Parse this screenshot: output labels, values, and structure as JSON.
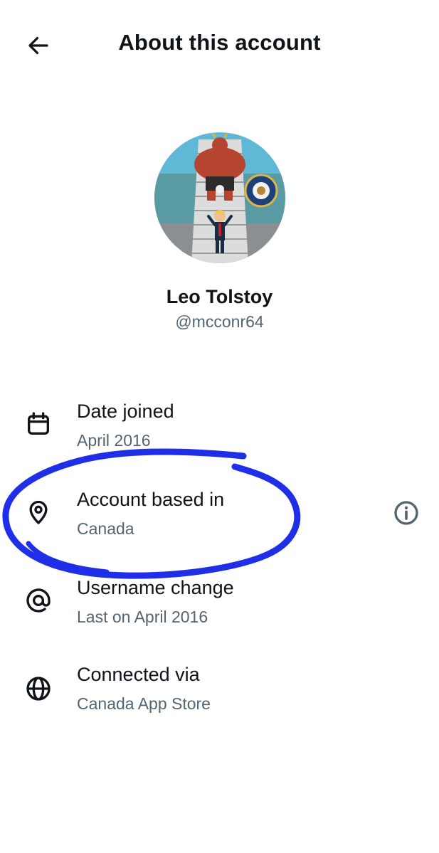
{
  "header": {
    "back_icon": "arrow-left-icon",
    "title": "About this account"
  },
  "profile": {
    "name": "Leo Tolstoy",
    "handle": "@mcconr64",
    "avatar_icon": "profile-avatar-cartoon"
  },
  "details": [
    {
      "icon": "calendar-icon",
      "label": "Date joined",
      "value": "April 2016"
    },
    {
      "icon": "location-pin-icon",
      "label": "Account based in",
      "value": "Canada",
      "trailing_icon": "info-icon"
    },
    {
      "icon": "at-sign-icon",
      "label": "Username change",
      "value": "Last on April 2016"
    },
    {
      "icon": "globe-icon",
      "label": "Connected via",
      "value": "Canada App Store"
    }
  ],
  "colors": {
    "text_primary": "#0f1419",
    "text_secondary": "#536471",
    "annotation_ink": "#1f2fe8"
  }
}
